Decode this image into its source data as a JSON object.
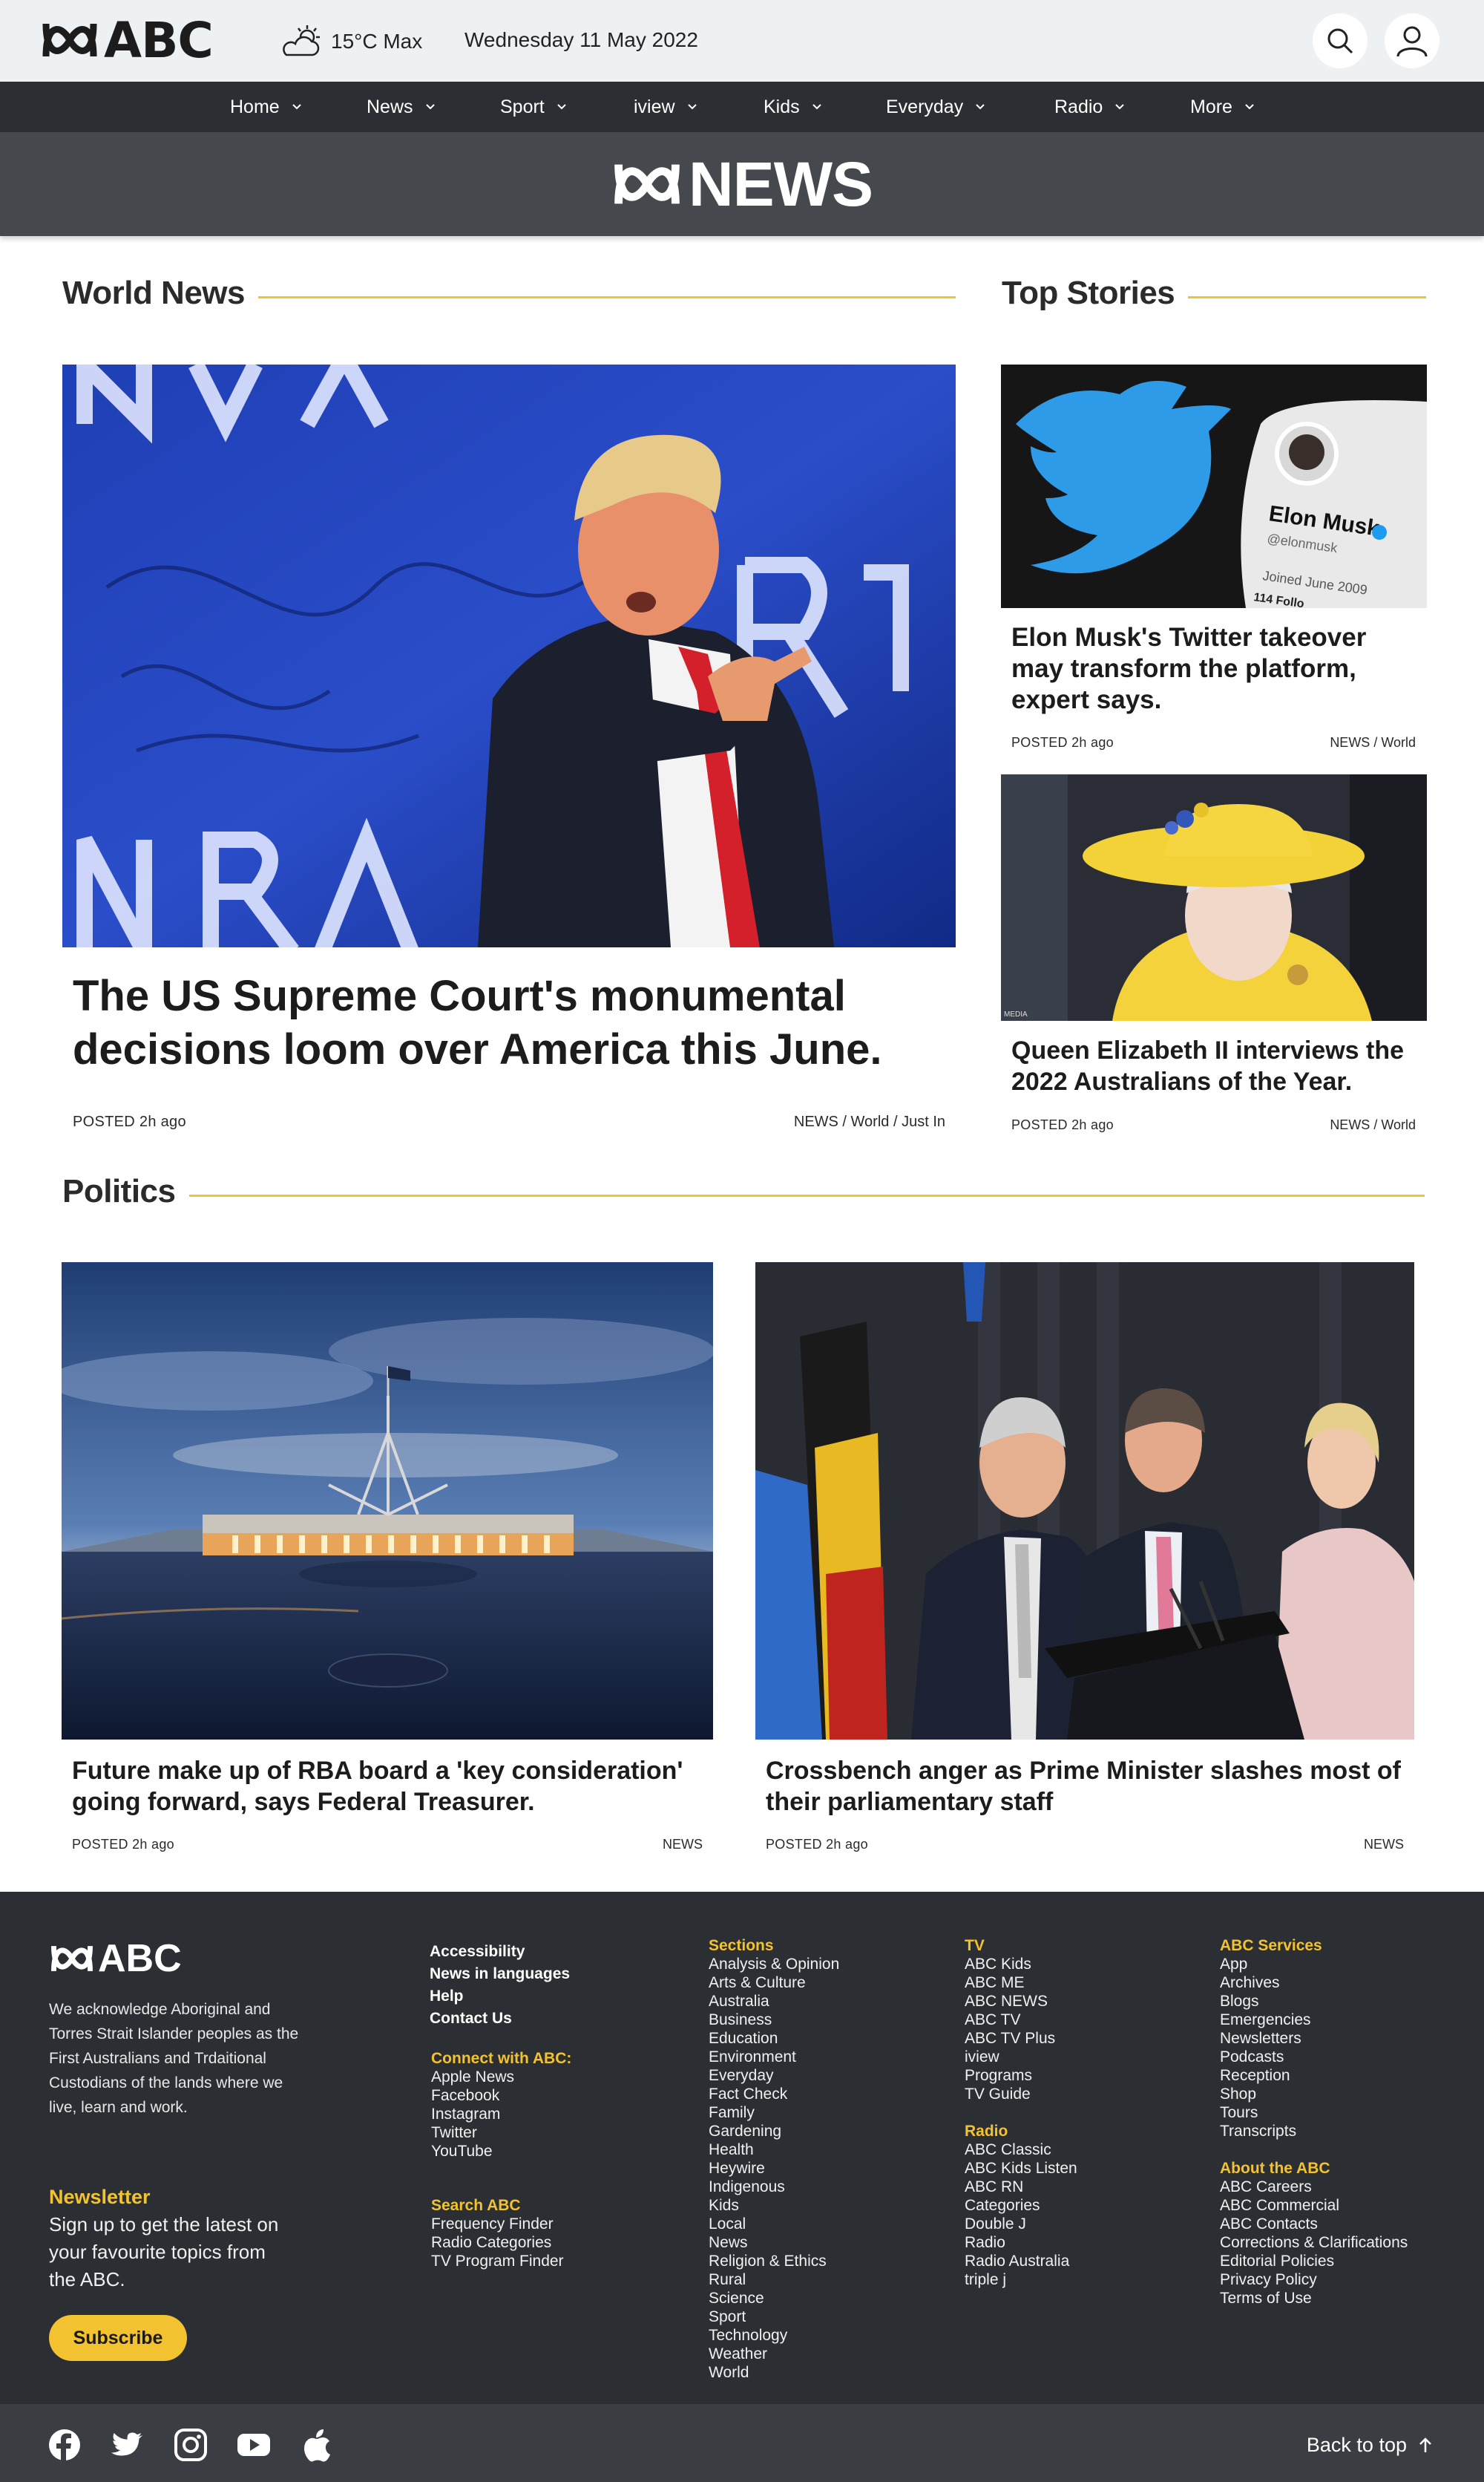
{
  "header": {
    "brand": "ABC",
    "weather": "15°C Max",
    "date": "Wednesday 11 May 2022",
    "icons": [
      "search-icon",
      "user-icon",
      "partly-cloudy-icon"
    ]
  },
  "nav": {
    "items": [
      {
        "label": "Home"
      },
      {
        "label": "News"
      },
      {
        "label": "Sport"
      },
      {
        "label": "iview"
      },
      {
        "label": "Kids"
      },
      {
        "label": "Everyday"
      },
      {
        "label": "Radio"
      },
      {
        "label": "More"
      }
    ]
  },
  "banner": {
    "title": "NEWS"
  },
  "world": {
    "heading": "World News",
    "headline": "The US Supreme Court's monumental decisions loom over America this June.",
    "posted": "POSTED 2h ago",
    "tags": "NEWS / World / Just In"
  },
  "top": {
    "heading": "Top Stories",
    "stories": [
      {
        "headline": "Elon Musk's Twitter takeover may transform the platform, expert says.",
        "posted": "POSTED 2h ago",
        "tags": "NEWS / World",
        "image_text": {
          "name": "Elon Musk",
          "handle": "@elonmusk",
          "joined": "Joined June 2009",
          "following": "114 Follo"
        }
      },
      {
        "headline": "Queen Elizabeth II interviews the 2022 Australians of the Year.",
        "posted": "POSTED 2h ago",
        "tags": "NEWS / World",
        "image_text": {
          "credit": "MEDIA"
        }
      }
    ]
  },
  "politics": {
    "heading": "Politics",
    "stories": [
      {
        "headline": "Future make up of RBA board a 'key consideration' going forward, says Federal Treasurer.",
        "posted": "POSTED 2h ago",
        "tags": "NEWS"
      },
      {
        "headline": "Crossbench anger as Prime Minister slashes most of their parliamentary staff",
        "posted": "POSTED 2h ago",
        "tags": "NEWS"
      }
    ]
  },
  "footer": {
    "brand": "ABC",
    "acknowledgement": "We acknowledge Aboriginal and Torres Strait Islander peoples as the First Australians and Trdaitional Custodians of the lands where we live, learn and work.",
    "newsletter_title": "Newsletter",
    "newsletter_text": "Sign up to get the latest on your favourite topics from the ABC.",
    "subscribe_label": "Subscribe",
    "col1_links": [
      "Accessibility",
      "News in languages",
      "Help",
      "Contact Us"
    ],
    "connect_heading": "Connect with ABC:",
    "connect_links": [
      "Apple News",
      "Facebook",
      "Instagram",
      "Twitter",
      "YouTube"
    ],
    "search_heading": "Search ABC",
    "search_links": [
      "Frequency Finder",
      "Radio Categories",
      "TV Program Finder"
    ],
    "sections_heading": "Sections",
    "sections_links": [
      "Analysis & Opinion",
      "Arts & Culture",
      "Australia",
      "Business",
      "Education",
      "Environment",
      "Everyday",
      "Fact Check",
      "Family",
      "Gardening",
      "Health",
      "Heywire",
      "Indigenous",
      "Kids",
      "Local",
      "News",
      "Religion & Ethics",
      "Rural",
      "Science",
      "Sport",
      "Technology",
      "Weather",
      "World"
    ],
    "tv_heading": "TV",
    "tv_links": [
      "ABC Kids",
      "ABC ME",
      "ABC NEWS",
      "ABC TV",
      "ABC TV Plus",
      "iview",
      "Programs",
      "TV Guide"
    ],
    "radio_heading": "Radio",
    "radio_links": [
      "ABC Classic",
      "ABC Kids Listen",
      "ABC RN",
      "Categories",
      "Double J",
      "Radio",
      "Radio Australia",
      "triple j"
    ],
    "services_heading": "ABC Services",
    "services_links": [
      "App",
      "Archives",
      "Blogs",
      "Emergencies",
      "Newsletters",
      "Podcasts",
      "Reception",
      "Shop",
      "Tours",
      "Transcripts"
    ],
    "about_heading": "About the ABC",
    "about_links": [
      "ABC Careers",
      "ABC Commercial",
      "ABC Contacts",
      "Corrections & Clarifications",
      "Editorial Policies",
      "Privacy Policy",
      "Terms of Use"
    ],
    "social_icons": [
      "facebook-icon",
      "twitter-icon",
      "instagram-icon",
      "youtube-icon",
      "apple-icon"
    ],
    "back_to_top": "Back to top"
  },
  "colors": {
    "accent": "#f2c230",
    "nav": "#2b2f33",
    "banner": "#45494e",
    "topbar": "#eef1f4"
  }
}
